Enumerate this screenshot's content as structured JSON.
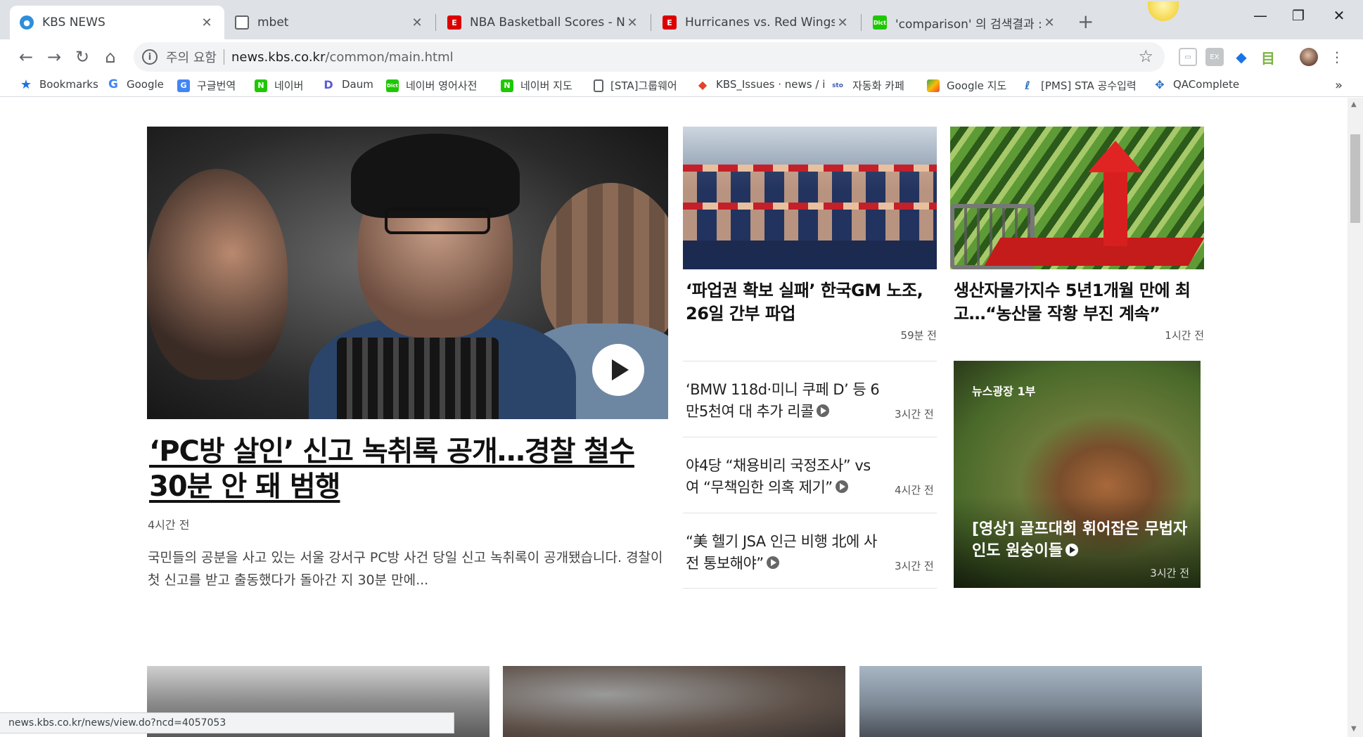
{
  "browser": {
    "tabs": [
      {
        "title": "KBS NEWS",
        "favicon": "kbs-icon",
        "active": true
      },
      {
        "title": "mbet",
        "favicon": "page-icon",
        "active": false
      },
      {
        "title": "NBA Basketball Scores - NBA Sc",
        "favicon": "espn-icon",
        "active": false
      },
      {
        "title": "Hurricanes vs. Red Wings - Live",
        "favicon": "espn-icon",
        "active": false
      },
      {
        "title": "'comparison' 의 검색결과 : 네이",
        "favicon": "naver-dict-icon",
        "active": false
      }
    ],
    "new_tab": "+",
    "address": {
      "security_label": "주의 요함",
      "host": "news.kbs.co.kr",
      "path": "/common/main.html"
    },
    "bookmarks": [
      {
        "label": "Bookmarks",
        "icon": "star-icon"
      },
      {
        "label": "Google",
        "icon": "google-icon"
      },
      {
        "label": "구글번역",
        "icon": "google-translate-icon"
      },
      {
        "label": "네이버",
        "icon": "naver-icon"
      },
      {
        "label": "Daum",
        "icon": "daum-icon"
      },
      {
        "label": "네이버 영어사전",
        "icon": "naver-dict-icon"
      },
      {
        "label": "네이버 지도",
        "icon": "naver-icon"
      },
      {
        "label": "[STA]그룹웨어",
        "icon": "page-icon"
      },
      {
        "label": "KBS_Issues · news / i",
        "icon": "gitlab-icon"
      },
      {
        "label": "자동화 카페",
        "icon": "cafe-icon"
      },
      {
        "label": "Google 지도",
        "icon": "google-maps-icon"
      },
      {
        "label": "[PMS] STA 공수입력",
        "icon": "pms-icon"
      },
      {
        "label": "QAComplete",
        "icon": "qacomplete-icon"
      }
    ],
    "bookmarks_overflow": "»",
    "status_url": "news.kbs.co.kr/news/view.do?ncd=4057053"
  },
  "headline": {
    "title": "‘PC방 살인’ 신고 녹취록 공개…경찰 철수 30분 안 돼 범행",
    "time": "4시간 전",
    "summary": "국민들의 공분을 사고 있는 서울 강서구 PC방 사건 당일 신고 녹취록이 공개됐습니다. 경찰이 첫 신고를 받고 출동했다가 돌아간 지 30분 만에..."
  },
  "top_cards": [
    {
      "title": "‘파업권 확보 실패’ 한국GM 노조, 26일 간부 파업",
      "time": "59분 전"
    },
    {
      "title": "생산자물가지수 5년1개월 만에 최고…“농산물 작황 부진 계속”",
      "time": "1시간 전"
    }
  ],
  "list_items": [
    {
      "title": "‘BMW 118d·미니 쿠페 D’ 등 6만5천여 대 추가 리콜",
      "time": "3시간 전",
      "has_video": true
    },
    {
      "title": "야4당 “채용비리 국정조사” vs 여 “무책임한 의혹 제기”",
      "time": "4시간 전",
      "has_video": true
    },
    {
      "title": "“美 헬기 JSA 인근 비행 北에 사전 통보해야”",
      "time": "3시간 전",
      "has_video": true
    }
  ],
  "video_card": {
    "program": "뉴스광장 1부",
    "title": "[영상] 골프대회 휘어잡은 무법자 인도 원숭이들",
    "time": "3시간 전"
  }
}
